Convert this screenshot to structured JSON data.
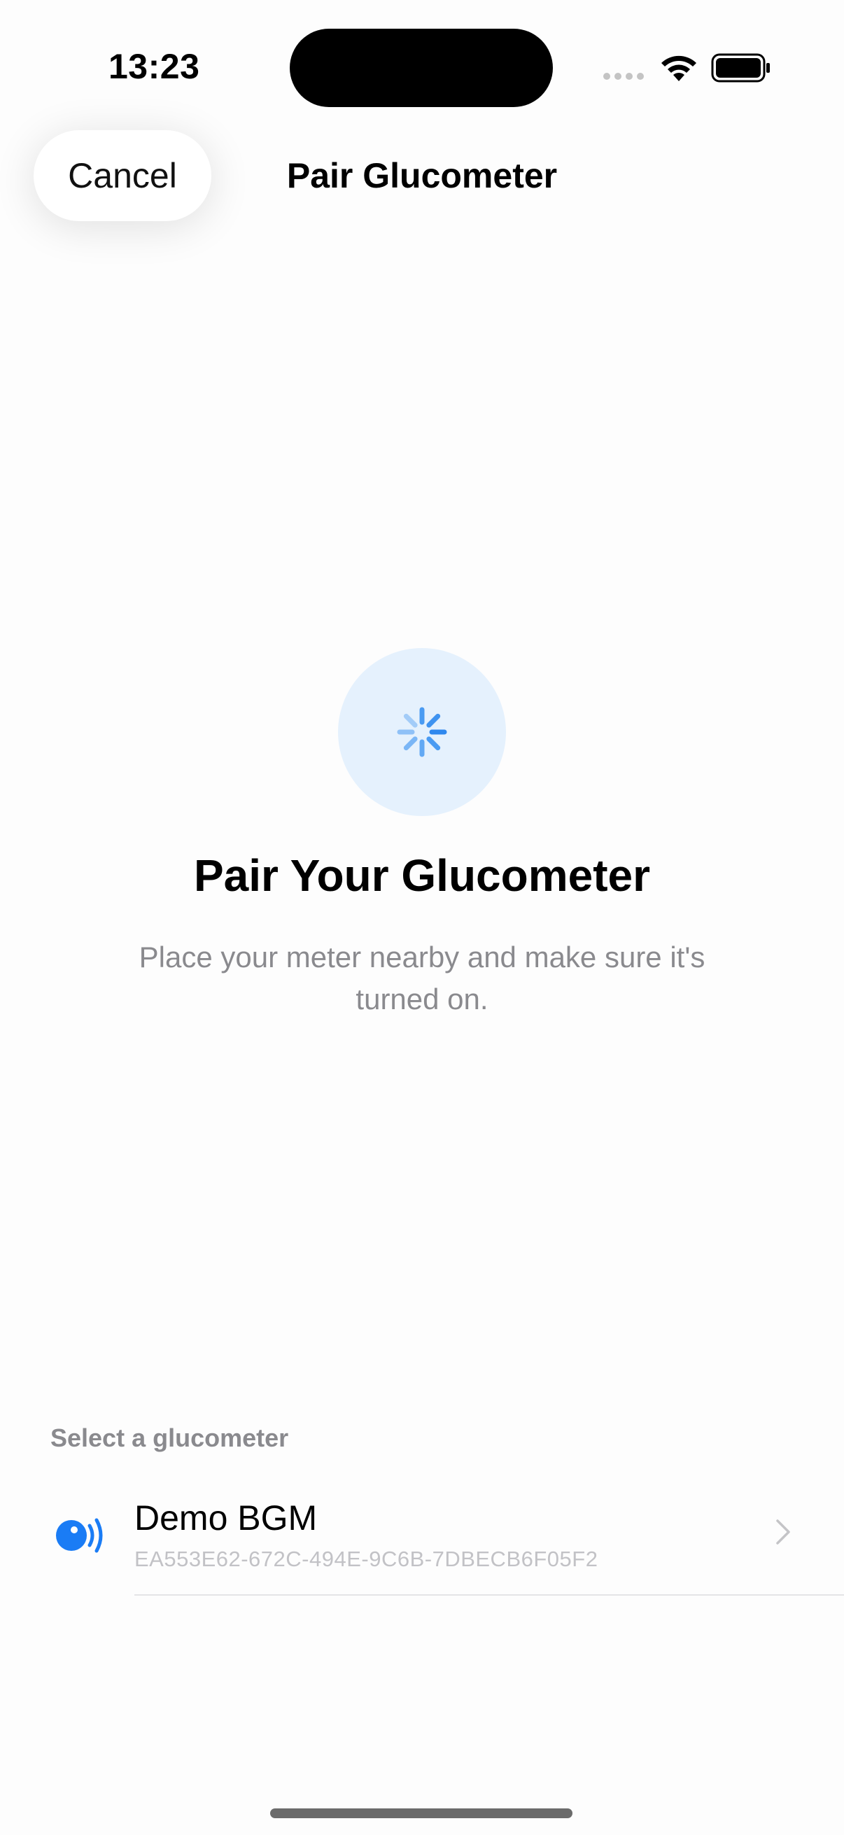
{
  "status_bar": {
    "time": "13:23"
  },
  "nav": {
    "cancel_label": "Cancel",
    "title": "Pair Glucometer"
  },
  "main": {
    "headline": "Pair Your Glucometer",
    "subtitle": "Place your meter nearby and make sure it's turned on."
  },
  "devices": {
    "section_header": "Select a glucometer",
    "items": [
      {
        "name": "Demo BGM",
        "identifier": "EA553E62-672C-494E-9C6B-7DBECB6F05F2"
      }
    ]
  },
  "colors": {
    "accent": "#1a7cf5",
    "spinner_bg": "#e5f1fd",
    "secondary_text": "#8a8a8e"
  }
}
